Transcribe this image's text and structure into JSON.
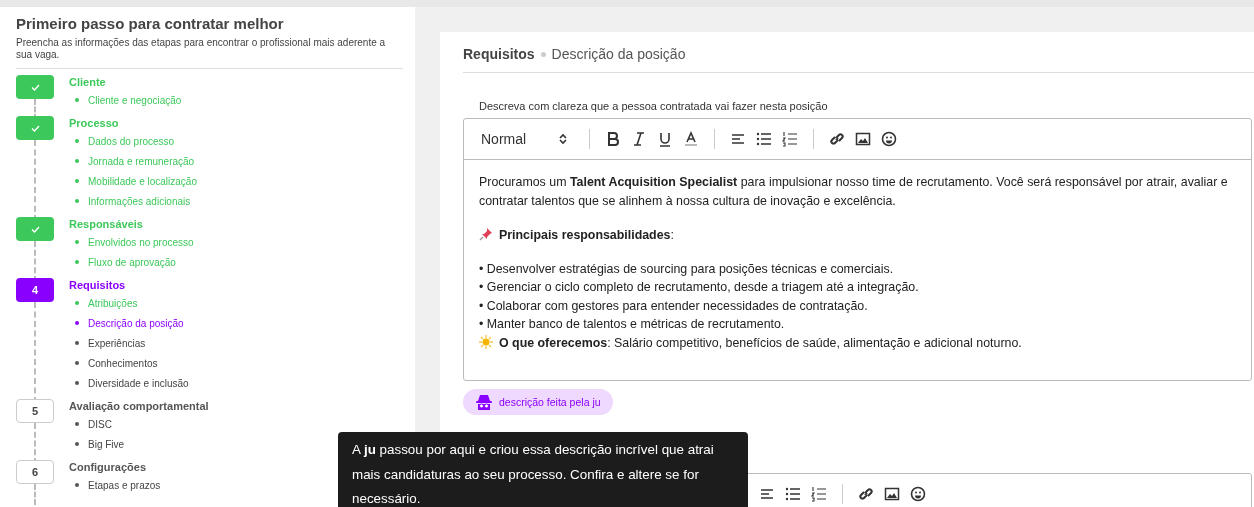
{
  "sidebar": {
    "title": "Primeiro passo para contratar melhor",
    "subtitle": "Preencha as informações das etapas para encontrar o profissional mais aderente a sua vaga.",
    "steps": [
      {
        "completed": true,
        "selected": false,
        "title": "Cliente",
        "items": [
          {
            "label": "Cliente e negociação",
            "completed": true,
            "selected": false
          }
        ]
      },
      {
        "completed": true,
        "selected": false,
        "title": "Processo",
        "items": [
          {
            "label": "Dados do processo",
            "completed": true,
            "selected": false
          },
          {
            "label": "Jornada e remuneração",
            "completed": true,
            "selected": false
          },
          {
            "label": "Mobilidade e localização",
            "completed": true,
            "selected": false
          },
          {
            "label": "Informações adicionais",
            "completed": true,
            "selected": false
          }
        ]
      },
      {
        "completed": true,
        "selected": false,
        "title": "Responsáveis",
        "items": [
          {
            "label": "Envolvidos no processo",
            "completed": true,
            "selected": false
          },
          {
            "label": "Fluxo de aprovação",
            "completed": true,
            "selected": false
          }
        ]
      },
      {
        "marker": "4",
        "completed": false,
        "selected": true,
        "title": "Requisitos",
        "items": [
          {
            "label": "Atribuições",
            "completed": true,
            "selected": false
          },
          {
            "label": "Descrição da posição",
            "selected": true
          },
          {
            "label": "Experiências",
            "completed": false,
            "selected": false
          },
          {
            "label": "Conhecimentos",
            "completed": false,
            "selected": false
          },
          {
            "label": "Diversidade e inclusão",
            "completed": false,
            "selected": false
          }
        ]
      },
      {
        "marker": "5",
        "completed": false,
        "selected": false,
        "title": "Avaliação comportamental",
        "items": [
          {
            "label": "DISC",
            "completed": false,
            "selected": false
          },
          {
            "label": "Big Five",
            "completed": false,
            "selected": false
          }
        ]
      },
      {
        "marker": "6",
        "completed": false,
        "selected": false,
        "title": "Configurações",
        "items": [
          {
            "label": "Etapas e prazos",
            "completed": false,
            "selected": false
          }
        ]
      }
    ]
  },
  "breadcrumb": {
    "section": "Requisitos",
    "page": "Descrição da posição"
  },
  "description_field": {
    "label": "Descreva com clareza que a pessoa contratada vai fazer nesta posição",
    "format_select": "Normal",
    "paragraphs": [
      {
        "kind": "text",
        "text": "Procuramos um **Talent Acquisition Specialist** para impulsionar nosso time de recrutamento. Você será responsável por atrair, avaliar e contratar talentos que se alinhem à nossa cultura de inovação e excelência."
      },
      {
        "kind": "pin",
        "text": "**Principais responsabilidades**:"
      },
      {
        "kind": "bullet",
        "text": "• Desenvolver estratégias de sourcing para posições técnicas e comerciais."
      },
      {
        "kind": "bullet",
        "text": "• Gerenciar o ciclo completo de recrutamento, desde a triagem até a integração."
      },
      {
        "kind": "bullet",
        "text": "• Colaborar com gestores para entender necessidades de contratação."
      },
      {
        "kind": "bullet",
        "text": "• Manter banco de talentos e métricas de recrutamento."
      },
      {
        "kind": "sun",
        "text": "**O que oferecemos**: Salário competitivo, benefícios de saúde, alimentação e adicional noturno."
      }
    ]
  },
  "ai_chip": "descrição feita pela ju",
  "tooltip": "A **ju** passou por aqui e criou essa descrição incrível que atrai mais candidaturas ao seu processo. Confira e altere se for necessário."
}
